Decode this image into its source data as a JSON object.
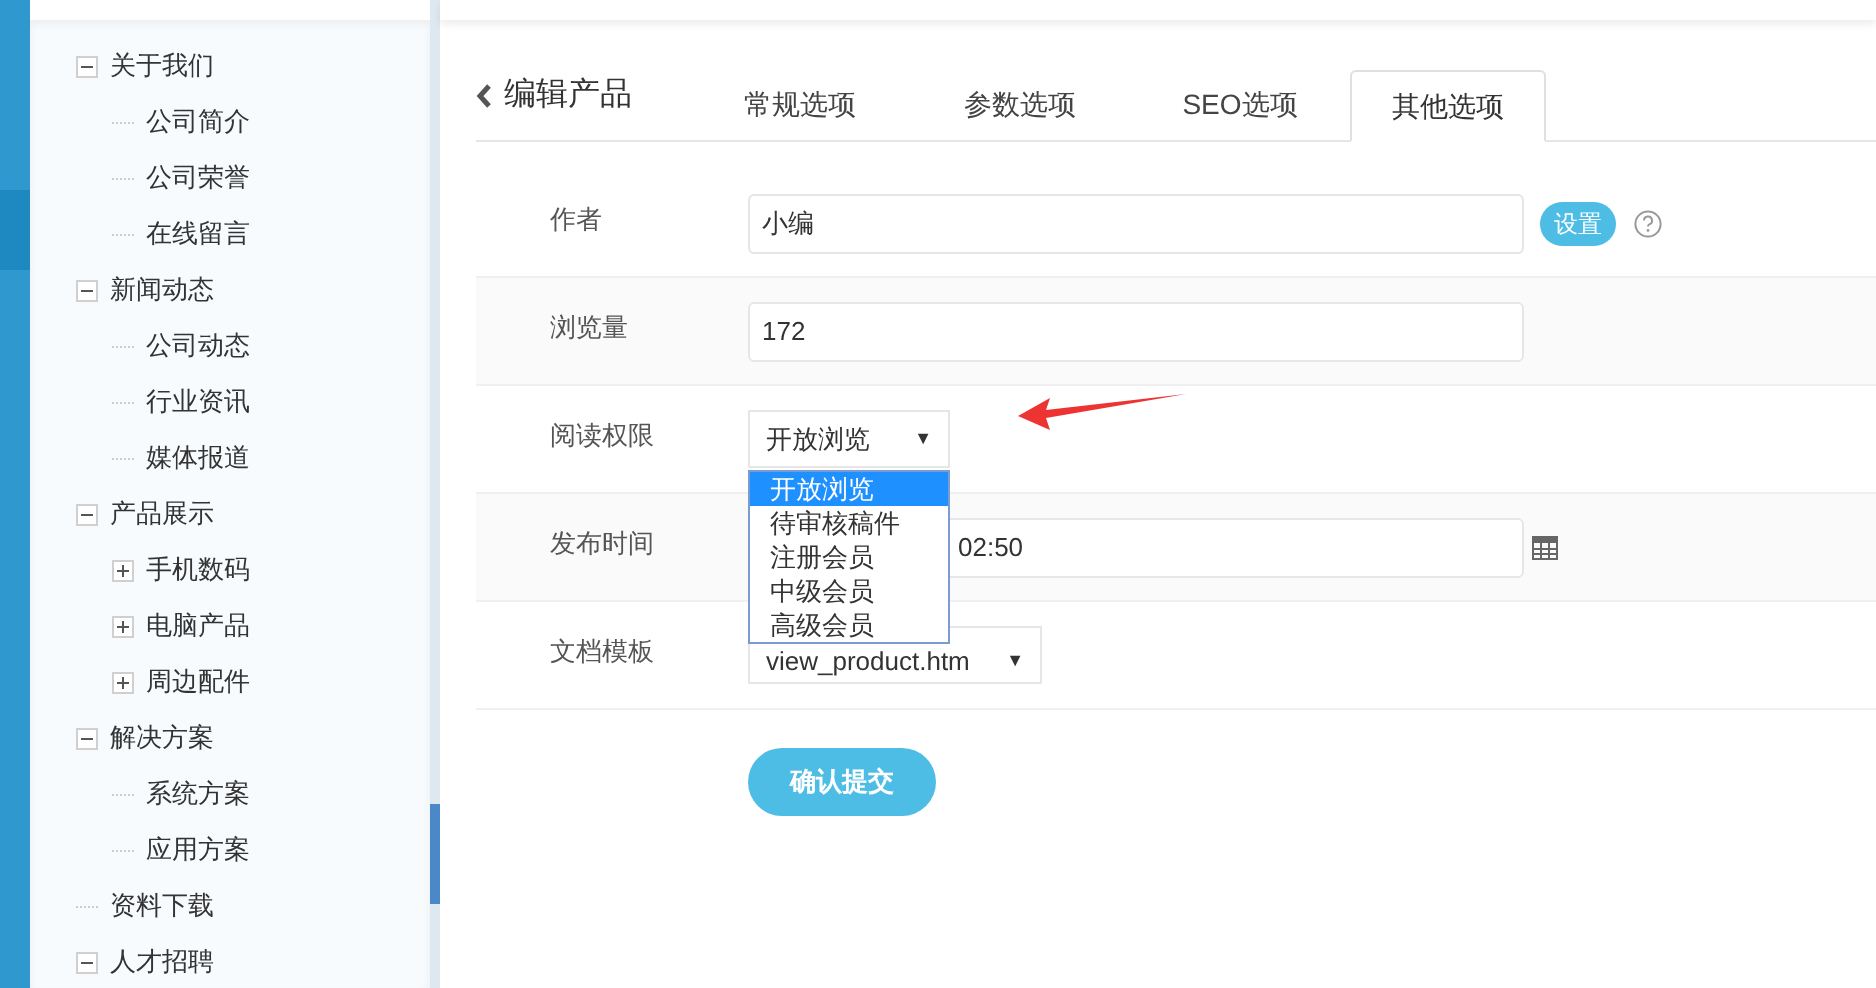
{
  "sidebar": {
    "tree": [
      {
        "label": "关于我们",
        "expanded": true,
        "children": [
          {
            "label": "公司简介"
          },
          {
            "label": "公司荣誉"
          },
          {
            "label": "在线留言"
          }
        ]
      },
      {
        "label": "新闻动态",
        "expanded": true,
        "children": [
          {
            "label": "公司动态"
          },
          {
            "label": "行业资讯"
          },
          {
            "label": "媒体报道"
          }
        ]
      },
      {
        "label": "产品展示",
        "expanded": true,
        "children": [
          {
            "label": "手机数码",
            "expanded": false
          },
          {
            "label": "电脑产品",
            "expanded": false
          },
          {
            "label": "周边配件",
            "expanded": false
          }
        ]
      },
      {
        "label": "解决方案",
        "expanded": true,
        "children": [
          {
            "label": "系统方案"
          },
          {
            "label": "应用方案"
          }
        ]
      },
      {
        "label": "资料下载"
      },
      {
        "label": "人才招聘",
        "expanded": true
      }
    ]
  },
  "page": {
    "back_title": "编辑产品"
  },
  "tabs": [
    {
      "label": "常规选项",
      "selected": false
    },
    {
      "label": "参数选项",
      "selected": false
    },
    {
      "label": "SEO选项",
      "selected": false
    },
    {
      "label": "其他选项",
      "selected": true
    }
  ],
  "form": [
    {
      "kind": "text",
      "label": "作者",
      "value": "小编",
      "button": "设置"
    },
    {
      "kind": "text",
      "label": "浏览量",
      "value": "172"
    },
    {
      "kind": "select",
      "label": "阅读权限",
      "value": "开放浏览",
      "caret": "▼",
      "options": [
        {
          "label": "开放浏览",
          "selected": true
        },
        {
          "label": "待审核稿件",
          "selected": false
        },
        {
          "label": "注册会员",
          "selected": false
        },
        {
          "label": "中级会员",
          "selected": false
        },
        {
          "label": "高级会员",
          "selected": false
        }
      ]
    },
    {
      "kind": "date",
      "label": "发布时间",
      "value": "02:50"
    },
    {
      "kind": "select",
      "label": "文档模板",
      "value": "view_product.htm",
      "caret": "▼"
    }
  ],
  "submit": "确认提交"
}
